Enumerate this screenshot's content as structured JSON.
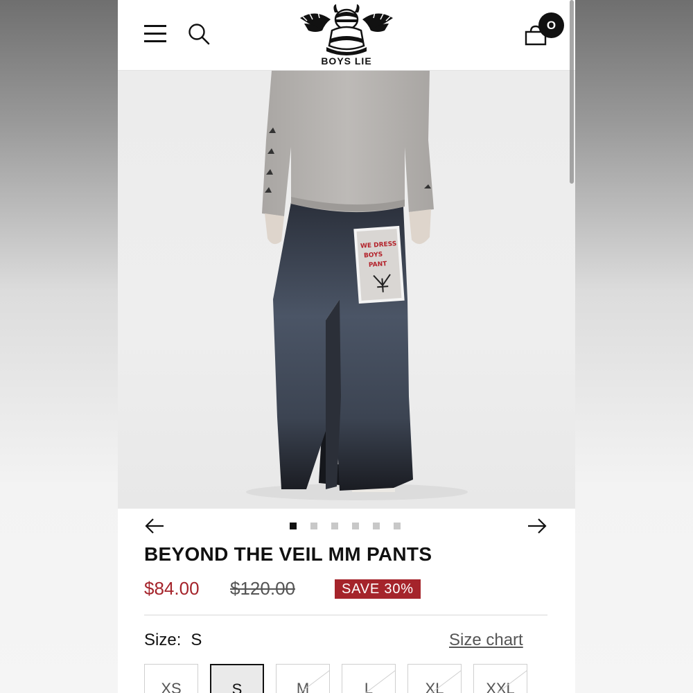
{
  "header": {
    "brand": "BOYS LIE",
    "cart_count": "O"
  },
  "gallery": {
    "dot_count": 6,
    "active_index": 0
  },
  "product": {
    "title": "BEYOND THE VEIL MM PANTS",
    "price": "$84.00",
    "compare_price": "$120.00",
    "save_badge": "SAVE 30%",
    "patch_text": [
      "WE DRESS",
      "BOYS",
      "PANT"
    ]
  },
  "size_selector": {
    "label": "Size:",
    "selected": "S",
    "size_chart_link": "Size chart",
    "options": [
      {
        "label": "XS",
        "available": true
      },
      {
        "label": "S",
        "available": true
      },
      {
        "label": "M",
        "available": false
      },
      {
        "label": "L",
        "available": false
      },
      {
        "label": "XL",
        "available": false
      },
      {
        "label": "XXL",
        "available": false
      }
    ]
  },
  "colors": {
    "sale_red": "#a5242b",
    "text": "#111111"
  }
}
